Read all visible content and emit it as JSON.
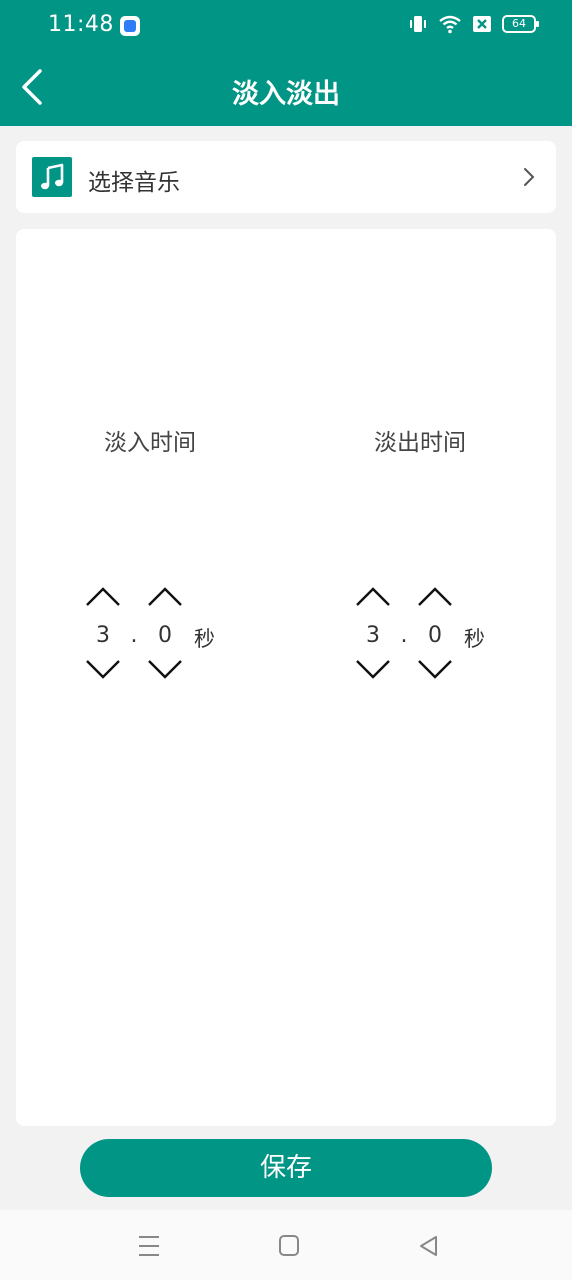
{
  "status_bar": {
    "time": "11:48",
    "battery": "64",
    "icons": [
      "app-notification-icon",
      "vibrate-icon",
      "wifi-icon",
      "sim-error-icon",
      "battery-icon"
    ]
  },
  "header": {
    "title": "淡入淡出",
    "back_icon": "chevron-left-icon"
  },
  "music": {
    "label": "选择音乐",
    "icon": "music-note-icon",
    "chevron_icon": "chevron-right-icon"
  },
  "fade_in": {
    "label": "淡入时间",
    "digit1": "3",
    "dot": ".",
    "digit2": "0",
    "unit": "秒"
  },
  "fade_out": {
    "label": "淡出时间",
    "digit1": "3",
    "dot": ".",
    "digit2": "0",
    "unit": "秒"
  },
  "save_label": "保存",
  "colors": {
    "brand": "#009585",
    "background": "#f2f2f2",
    "card": "#ffffff",
    "text": "#333333"
  },
  "nav_bar": {
    "icons": [
      "menu-icon",
      "home-icon",
      "back-triangle-icon"
    ]
  }
}
